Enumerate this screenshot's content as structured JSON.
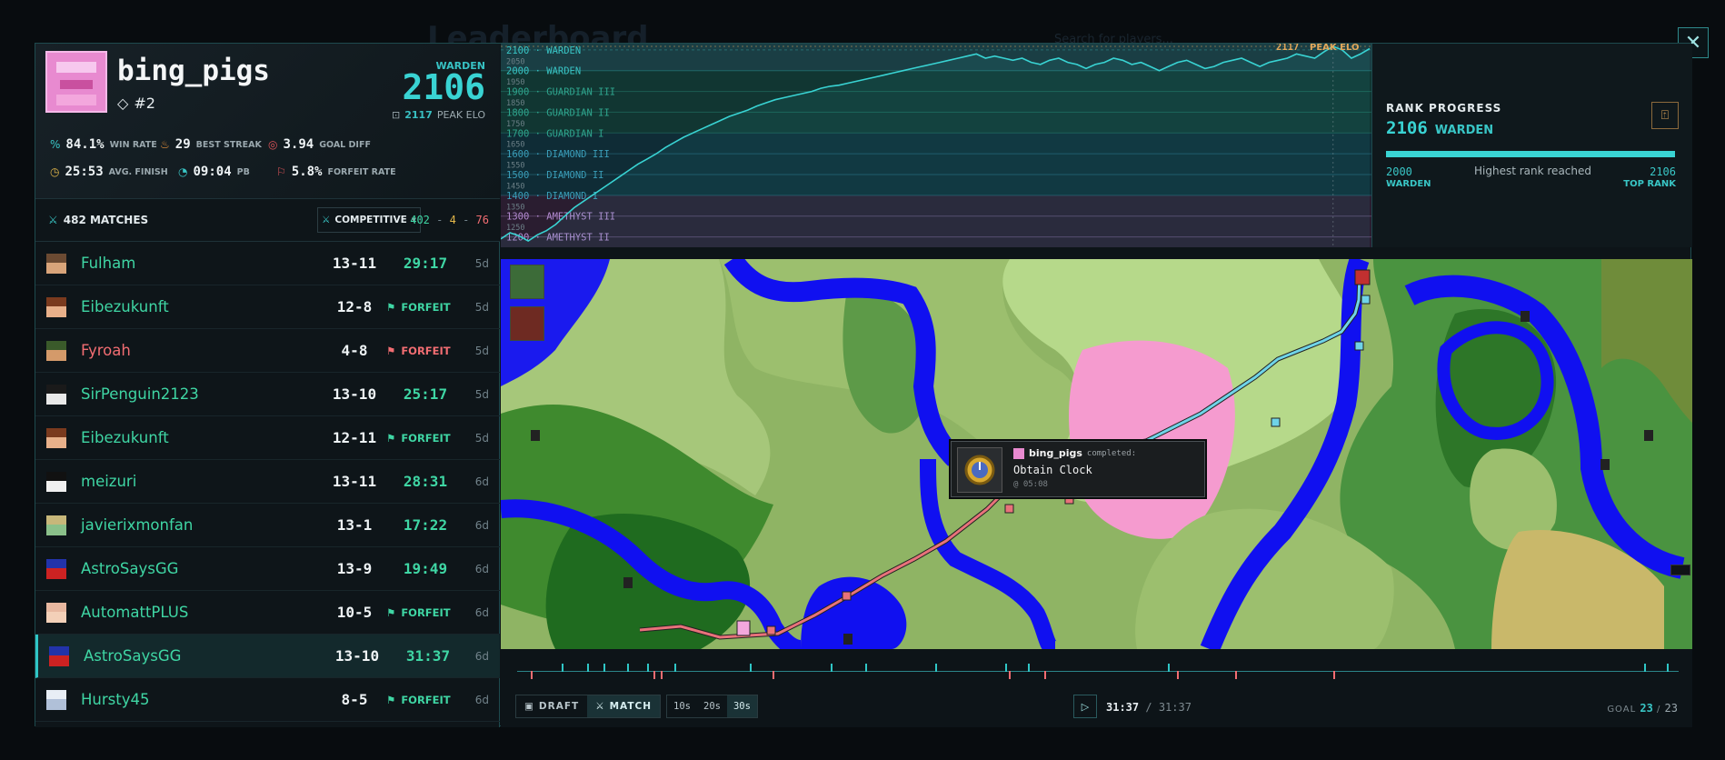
{
  "background": {
    "title": "Leaderboard",
    "search_placeholder": "Search for players..."
  },
  "profile": {
    "username": "bing_pigs",
    "rank_position": "#2",
    "tier": "WARDEN",
    "elo": "2106",
    "peak_value": "2117",
    "peak_label": "PEAK ELO"
  },
  "stats": [
    {
      "value": "84.1%",
      "label": "WIN RATE",
      "icon": "percent-icon"
    },
    {
      "value": "29",
      "label": "BEST STREAK",
      "icon": "flame-icon"
    },
    {
      "value": "3.94",
      "label": "GOAL DIFF",
      "icon": "target-icon"
    },
    {
      "value": "25:53",
      "label": "AVG. FINISH",
      "icon": "clock-icon"
    },
    {
      "value": "09:04",
      "label": "PB",
      "icon": "speed-icon"
    },
    {
      "value": "5.8%",
      "label": "FORFEIT RATE",
      "icon": "flag-icon"
    }
  ],
  "matches_header": {
    "count": "482 MATCHES",
    "mode": "COMPETITIVE",
    "wins": "402",
    "draws": "4",
    "losses": "76",
    "sep": "-"
  },
  "matches": [
    {
      "opponent": "Fulham",
      "score": "13-11",
      "time": "29:17",
      "forfeit": "",
      "ago": "5d",
      "result": "win",
      "face": [
        "#6b4a32",
        "#d8a47a"
      ]
    },
    {
      "opponent": "Eibezukunft",
      "score": "12-8",
      "time": "",
      "forfeit": "FORFEIT",
      "ago": "5d",
      "result": "win",
      "face": [
        "#7a3a1e",
        "#e8b08a"
      ]
    },
    {
      "opponent": "Fyroah",
      "score": "4-8",
      "time": "",
      "forfeit": "FORFEIT",
      "ago": "5d",
      "result": "loss",
      "face": [
        "#3a5a2a",
        "#d49a6a"
      ]
    },
    {
      "opponent": "SirPenguin2123",
      "score": "13-10",
      "time": "25:17",
      "forfeit": "",
      "ago": "5d",
      "result": "win",
      "face": [
        "#1a1a1a",
        "#e8e8e8"
      ]
    },
    {
      "opponent": "Eibezukunft",
      "score": "12-11",
      "time": "",
      "forfeit": "FORFEIT",
      "ago": "5d",
      "result": "win",
      "face": [
        "#7a3a1e",
        "#e8b08a"
      ]
    },
    {
      "opponent": "meizuri",
      "score": "13-11",
      "time": "28:31",
      "forfeit": "",
      "ago": "6d",
      "result": "win",
      "face": [
        "#111111",
        "#f0f0f0"
      ]
    },
    {
      "opponent": "javierixmonfan",
      "score": "13-1",
      "time": "17:22",
      "forfeit": "",
      "ago": "6d",
      "result": "win",
      "face": [
        "#c7b77a",
        "#8ac08a"
      ]
    },
    {
      "opponent": "AstroSaysGG",
      "score": "13-9",
      "time": "19:49",
      "forfeit": "",
      "ago": "6d",
      "result": "win",
      "face": [
        "#2233aa",
        "#cc2222"
      ]
    },
    {
      "opponent": "AutomattPLUS",
      "score": "10-5",
      "time": "",
      "forfeit": "FORFEIT",
      "ago": "6d",
      "result": "win",
      "face": [
        "#e8b8a0",
        "#f3d0b8"
      ]
    },
    {
      "opponent": "AstroSaysGG",
      "score": "13-10",
      "time": "31:37",
      "forfeit": "",
      "ago": "6d",
      "result": "win",
      "face": [
        "#2233aa",
        "#cc2222"
      ],
      "active": true
    },
    {
      "opponent": "Hursty45",
      "score": "8-5",
      "time": "",
      "forfeit": "FORFEIT",
      "ago": "6d",
      "result": "win",
      "face": [
        "#e8eef5",
        "#b0c0d8"
      ]
    }
  ],
  "chart_data": {
    "type": "line",
    "title": "",
    "ylim": [
      1150,
      2130
    ],
    "rank_bands": [
      {
        "label": "2100 · WARDEN",
        "elo": 2100,
        "color": "#39c6c6"
      },
      {
        "label": "2000 · WARDEN",
        "elo": 2000,
        "color": "#39c6c6"
      },
      {
        "label": "1900 · GUARDIAN III",
        "elo": 1900,
        "color": "#2fa58e"
      },
      {
        "label": "1800 · GUARDIAN II",
        "elo": 1800,
        "color": "#2fa58e"
      },
      {
        "label": "1700 · GUARDIAN I",
        "elo": 1700,
        "color": "#2fa58e"
      },
      {
        "label": "1600 · DIAMOND III",
        "elo": 1600,
        "color": "#3a9db8"
      },
      {
        "label": "1500 · DIAMOND II",
        "elo": 1500,
        "color": "#3a9db8"
      },
      {
        "label": "1400 · DIAMOND I",
        "elo": 1400,
        "color": "#3a9db8"
      },
      {
        "label": "1300 · AMETHYST III",
        "elo": 1300,
        "color": "#b38ad0"
      },
      {
        "label": "1200 · AMETHYST II",
        "elo": 1200,
        "color": "#b38ad0"
      }
    ],
    "minor_ticks": [
      "2050",
      "1950",
      "1850",
      "1750",
      "1650",
      "1550",
      "1450",
      "1350",
      "1250"
    ],
    "peak": {
      "value": "2117",
      "label": "PEAK ELO"
    },
    "series": [
      {
        "values": [
          1190,
          1220,
          1205,
          1180,
          1210,
          1230,
          1260,
          1300,
          1340,
          1370,
          1400,
          1430,
          1460,
          1490,
          1520,
          1550,
          1575,
          1600,
          1630,
          1655,
          1680,
          1700,
          1720,
          1740,
          1760,
          1780,
          1795,
          1810,
          1830,
          1845,
          1860,
          1870,
          1880,
          1890,
          1900,
          1915,
          1925,
          1930,
          1940,
          1950,
          1960,
          1970,
          1980,
          1990,
          2000,
          2010,
          2020,
          2030,
          2040,
          2050,
          2060,
          2070,
          2080,
          2060,
          2070,
          2060,
          2050,
          2060,
          2040,
          2030,
          2050,
          2060,
          2040,
          2030,
          2010,
          2030,
          2040,
          2060,
          2050,
          2030,
          2040,
          2020,
          2000,
          2020,
          2040,
          2050,
          2030,
          2010,
          2020,
          2040,
          2050,
          2060,
          2040,
          2020,
          2040,
          2050,
          2060,
          2080,
          2070,
          2060,
          2090,
          2117,
          2100,
          2060,
          2080,
          2106
        ]
      }
    ]
  },
  "rank_progress": {
    "title": "RANK PROGRESS",
    "elo": "2106",
    "tier": "WARDEN",
    "left_value": "2000",
    "left_label": "WARDEN",
    "middle": "Highest rank reached",
    "right_value": "2106",
    "right_label": "TOP RANK",
    "progress": 1.0
  },
  "tooltip": {
    "player": "bing_pigs",
    "verb": "completed:",
    "advancement": "Obtain Clock",
    "time": "@ 05:08"
  },
  "controls": {
    "draft": "DRAFT",
    "match": "MATCH",
    "speeds": [
      "10s",
      "20s",
      "30s"
    ],
    "current_time": "31:37",
    "separator": "/",
    "total_time": "31:37",
    "goal_label": "GOAL",
    "goal_done": "23",
    "goal_total": "23"
  },
  "timeline_marks": {
    "red": [
      0.012,
      0.117,
      0.124,
      0.22,
      0.423,
      0.454,
      0.568,
      0.618,
      0.703
    ],
    "teal": [
      0.038,
      0.06,
      0.074,
      0.095,
      0.112,
      0.135,
      0.2,
      0.27,
      0.3,
      0.36,
      0.42,
      0.44,
      0.56,
      0.97,
      0.99
    ]
  },
  "colors": {
    "accent": "#39d3d3",
    "win": "#3fd6a4",
    "loss": "#f26d72"
  }
}
